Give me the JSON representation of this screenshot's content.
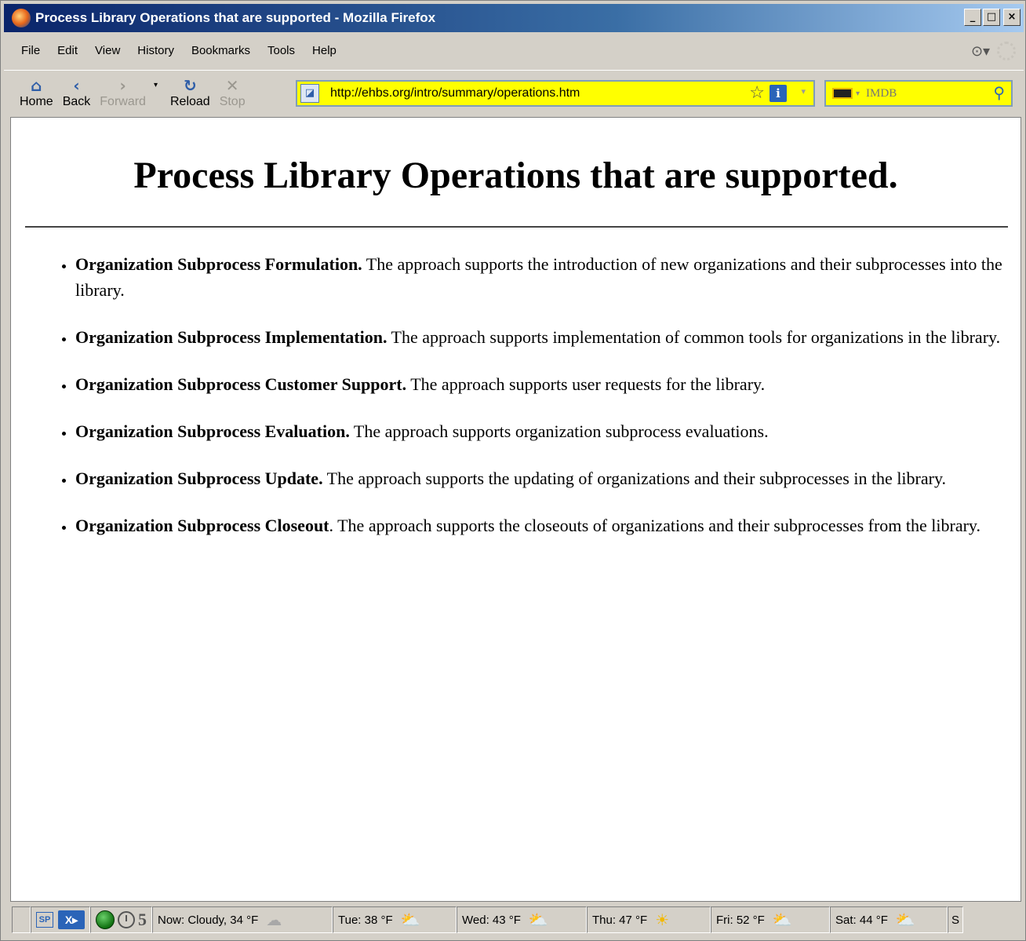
{
  "window": {
    "title": "Process Library Operations that are supported - Mozilla Firefox",
    "buttons": {
      "minimize": "_",
      "maximize": "□",
      "close": "×"
    }
  },
  "menu": [
    "File",
    "Edit",
    "View",
    "History",
    "Bookmarks",
    "Tools",
    "Help"
  ],
  "toolbar": {
    "home": "Home",
    "back": "Back",
    "forward": "Forward",
    "reload": "Reload",
    "stop": "Stop"
  },
  "address": {
    "url": "http://ehbs.org/intro/summary/operations.htm"
  },
  "search": {
    "placeholder": "IMDB"
  },
  "page": {
    "title": "Process Library Operations that are supported.",
    "items": [
      {
        "term": "Organization Subprocess Formulation.",
        "desc": " The approach supports the introduction of new organizations and their subprocesses into the library."
      },
      {
        "term": "Organization Subprocess Implementation.",
        "desc": " The approach supports implementation of common tools for organizations in the library."
      },
      {
        "term": "Organization Subprocess Customer Support.",
        "desc": " The approach supports user requests for the library."
      },
      {
        "term": "Organization Subprocess Evaluation.",
        "desc": " The approach supports organization subprocess evaluations."
      },
      {
        "term": "Organization Subprocess Update.",
        "desc": " The approach supports the updating of organizations and their subprocesses in the library."
      },
      {
        "term": "Organization Subprocess Closeout",
        "desc": ". The approach supports the closeouts of organizations and their subprocesses from the library."
      }
    ]
  },
  "statusbar": {
    "sp": "SP",
    "xm": "X▸",
    "count": "5",
    "weather": [
      {
        "text": "Now: Cloudy, 34 °F",
        "icon": "cloudy-icon"
      },
      {
        "text": "Tue: 38 °F",
        "icon": "partly-cloudy-icon"
      },
      {
        "text": "Wed: 43 °F",
        "icon": "partly-cloudy-icon"
      },
      {
        "text": "Thu: 47 °F",
        "icon": "sun-icon"
      },
      {
        "text": "Fri: 52 °F",
        "icon": "partly-cloudy-icon"
      },
      {
        "text": "Sat: 44 °F",
        "icon": "partly-cloudy-icon"
      }
    ],
    "overflow": "S"
  },
  "colors": {
    "urlbar_bg": "#ffff00",
    "titlebar_start": "#0a246a",
    "titlebar_end": "#a6caf0"
  }
}
